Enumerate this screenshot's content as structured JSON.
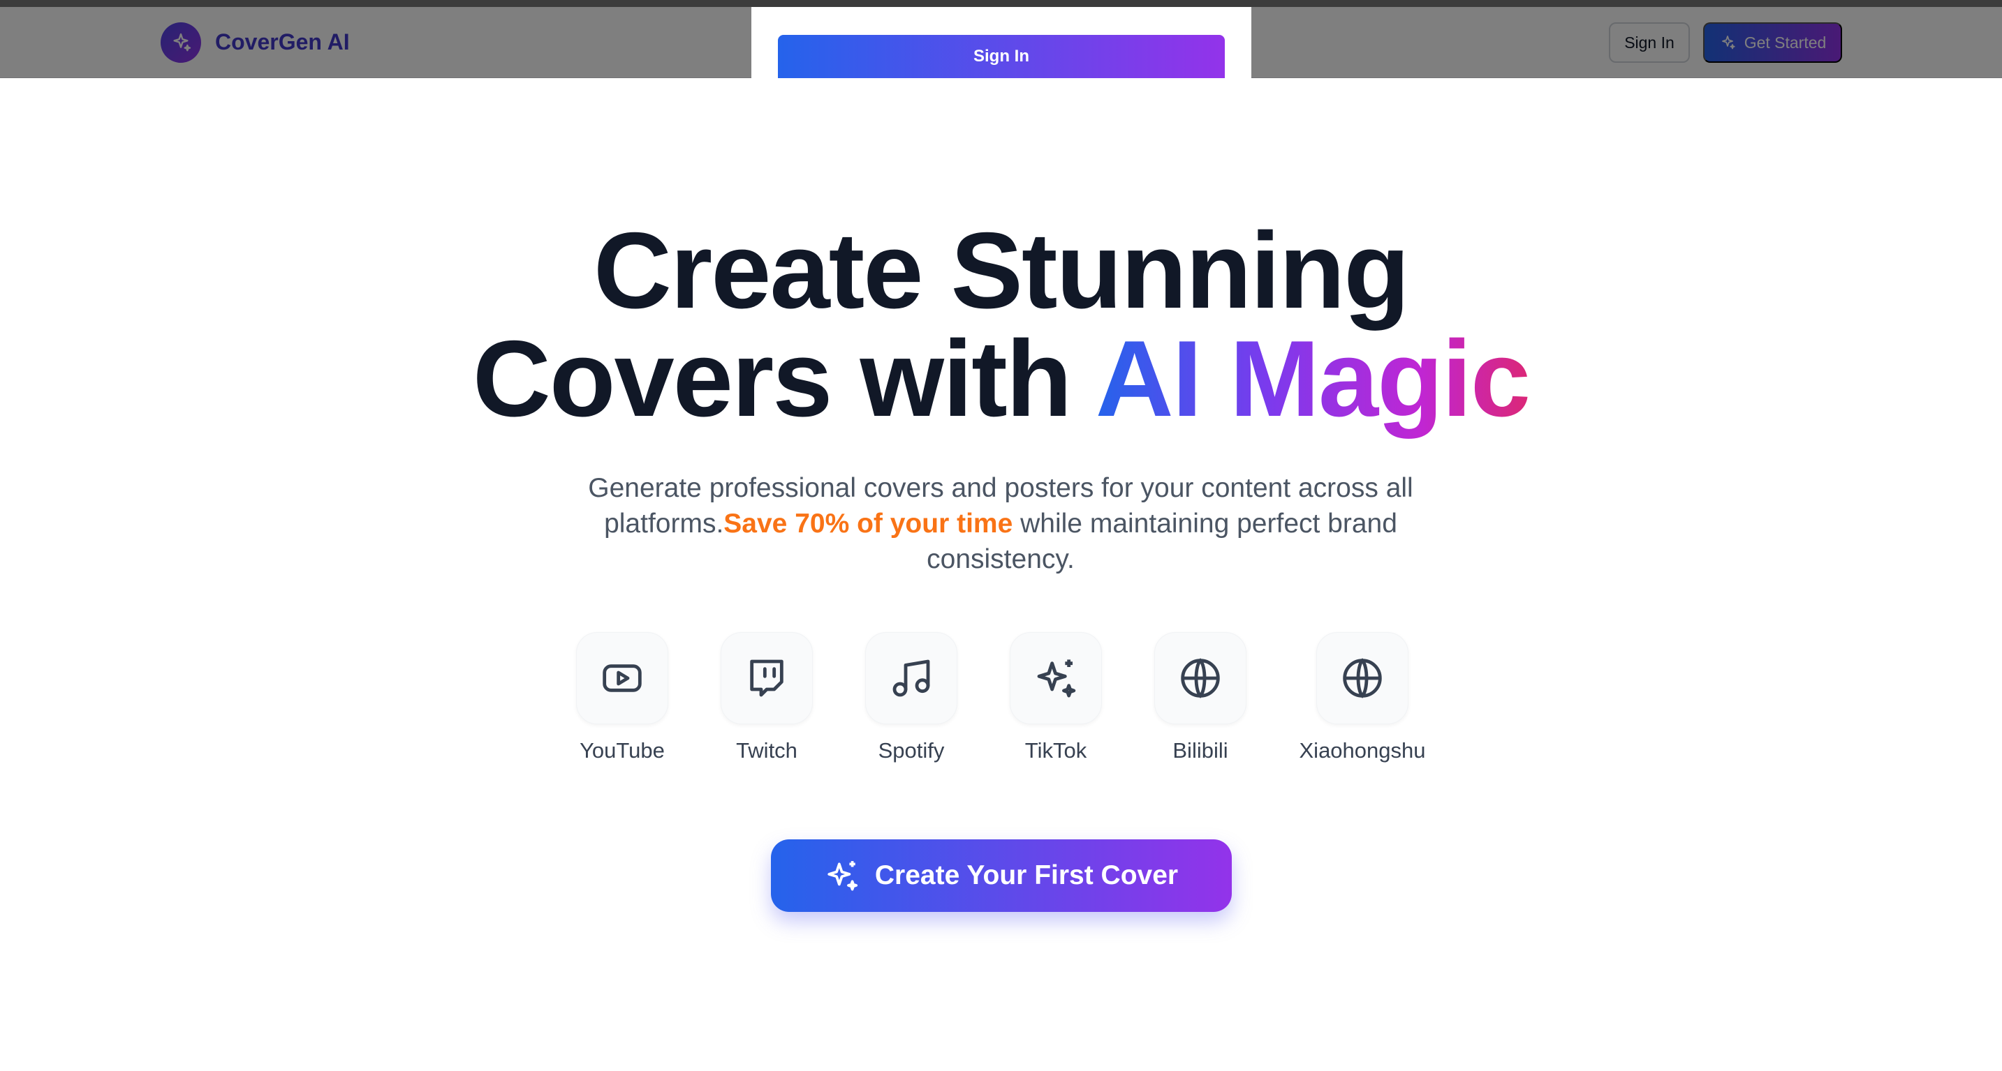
{
  "navbar": {
    "brand": "CoverGen AI",
    "brand_icon": "sparkles-icon",
    "sign_in_label": "Sign In",
    "get_started_label": "Get Started",
    "get_started_icon": "sparkles-icon"
  },
  "modal": {
    "sign_in_button_label": "Sign In"
  },
  "hero": {
    "headline_line1": "Create Stunning",
    "headline_line2_plain": "Covers with ",
    "headline_line2_gradient": "AI Magic",
    "subtitle_part1": "Generate professional covers and posters for your content across all platforms.",
    "subtitle_highlight": "Save 70% of your time",
    "subtitle_part2": " while maintaining perfect brand consistency.",
    "cta_label": "Create Your First Cover",
    "cta_icon": "sparkles-icon"
  },
  "platforms": [
    {
      "label": "YouTube",
      "icon": "youtube-icon"
    },
    {
      "label": "Twitch",
      "icon": "twitch-icon"
    },
    {
      "label": "Spotify",
      "icon": "music-note-icon"
    },
    {
      "label": "TikTok",
      "icon": "sparkles-icon"
    },
    {
      "label": "Bilibili",
      "icon": "globe-icon"
    },
    {
      "label": "Xiaohongshu",
      "icon": "globe-icon"
    }
  ],
  "colors": {
    "brand_gradient_start": "#2563eb",
    "brand_gradient_end": "#9333ea",
    "highlight": "#f97316",
    "headline": "#111827"
  }
}
